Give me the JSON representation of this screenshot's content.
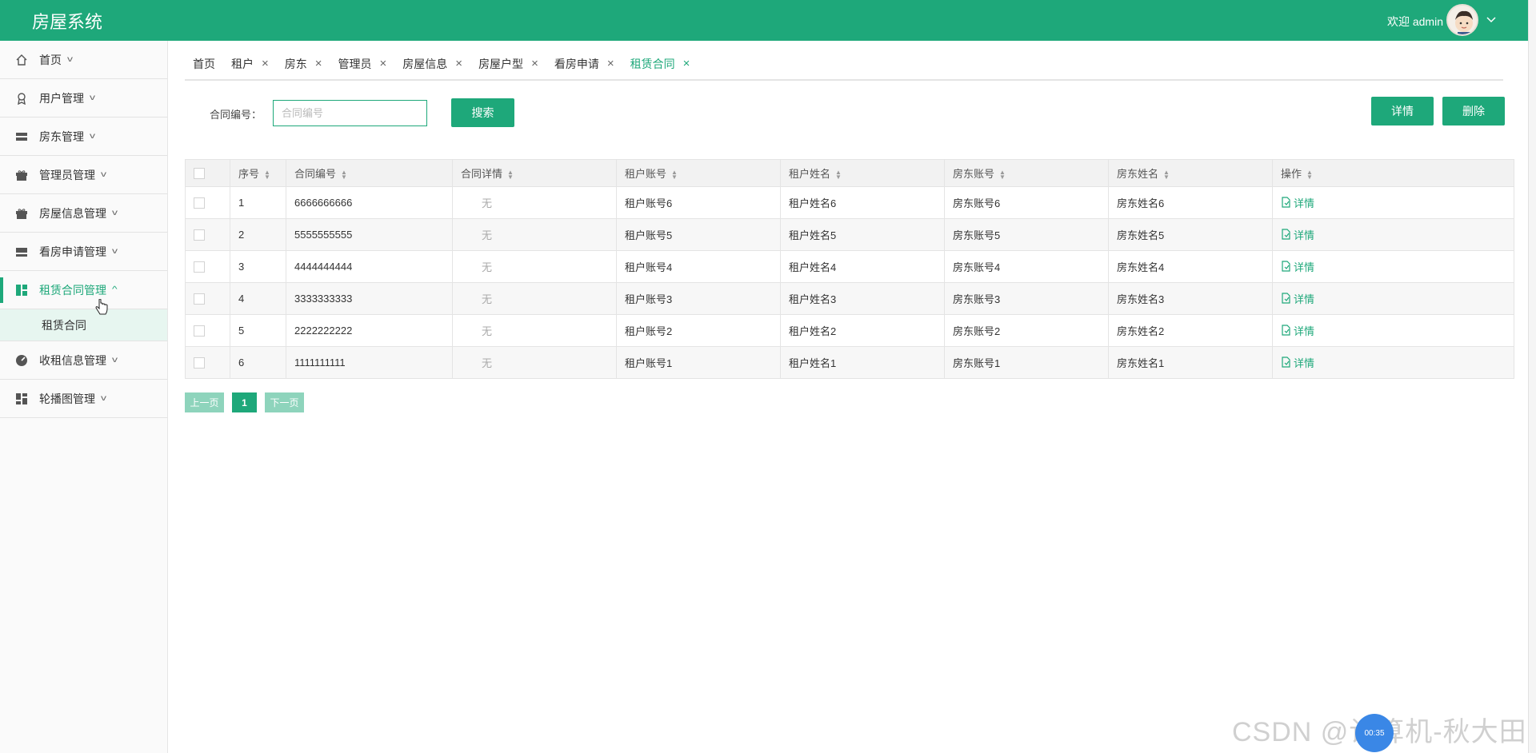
{
  "header": {
    "app_title": "房屋系统",
    "welcome": "欢迎 admin"
  },
  "sidebar": {
    "items": [
      {
        "label": "首页",
        "icon": "home-icon"
      },
      {
        "label": "用户管理",
        "icon": "badge-icon"
      },
      {
        "label": "房东管理",
        "icon": "list-icon"
      },
      {
        "label": "管理员管理",
        "icon": "gift-icon"
      },
      {
        "label": "房屋信息管理",
        "icon": "gift-icon"
      },
      {
        "label": "看房申请管理",
        "icon": "list-icon"
      },
      {
        "label": "租赁合同管理",
        "icon": "dashboard-icon",
        "active": true
      },
      {
        "label": "收租信息管理",
        "icon": "gauge-icon"
      },
      {
        "label": "轮播图管理",
        "icon": "grid-icon"
      }
    ],
    "submenu": {
      "label": "租赁合同"
    }
  },
  "tabs": [
    {
      "label": "首页",
      "closable": false
    },
    {
      "label": "租户",
      "closable": true
    },
    {
      "label": "房东",
      "closable": true
    },
    {
      "label": "管理员",
      "closable": true
    },
    {
      "label": "房屋信息",
      "closable": true
    },
    {
      "label": "房屋户型",
      "closable": true
    },
    {
      "label": "看房申请",
      "closable": true
    },
    {
      "label": "租赁合同",
      "closable": true,
      "active": true
    }
  ],
  "search": {
    "label": "合同编号：",
    "placeholder": "合同编号",
    "value": "",
    "button": "搜索"
  },
  "actions": {
    "detail": "详情",
    "delete": "删除"
  },
  "table": {
    "headers": [
      "序号",
      "合同编号",
      "合同详情",
      "租户账号",
      "租户姓名",
      "房东账号",
      "房东姓名",
      "操作"
    ],
    "rows": [
      {
        "no": "1",
        "contract_no": "6666666666",
        "detail": "无",
        "tenant_account": "租户账号6",
        "tenant_name": "租户姓名6",
        "landlord_account": "房东账号6",
        "landlord_name": "房东姓名6",
        "op": "详情"
      },
      {
        "no": "2",
        "contract_no": "5555555555",
        "detail": "无",
        "tenant_account": "租户账号5",
        "tenant_name": "租户姓名5",
        "landlord_account": "房东账号5",
        "landlord_name": "房东姓名5",
        "op": "详情"
      },
      {
        "no": "3",
        "contract_no": "4444444444",
        "detail": "无",
        "tenant_account": "租户账号4",
        "tenant_name": "租户姓名4",
        "landlord_account": "房东账号4",
        "landlord_name": "房东姓名4",
        "op": "详情"
      },
      {
        "no": "4",
        "contract_no": "3333333333",
        "detail": "无",
        "tenant_account": "租户账号3",
        "tenant_name": "租户姓名3",
        "landlord_account": "房东账号3",
        "landlord_name": "房东姓名3",
        "op": "详情"
      },
      {
        "no": "5",
        "contract_no": "2222222222",
        "detail": "无",
        "tenant_account": "租户账号2",
        "tenant_name": "租户姓名2",
        "landlord_account": "房东账号2",
        "landlord_name": "房东姓名2",
        "op": "详情"
      },
      {
        "no": "6",
        "contract_no": "1111111111",
        "detail": "无",
        "tenant_account": "租户账号1",
        "tenant_name": "租户姓名1",
        "landlord_account": "房东账号1",
        "landlord_name": "房东姓名1",
        "op": "详情"
      }
    ]
  },
  "pagination": {
    "prev": "上一页",
    "current": "1",
    "next": "下一页"
  },
  "watermark": "CSDN @计算机-秋大田",
  "float_ball": "00:35",
  "colors": {
    "accent": "#1ea87a",
    "accent_light": "#8ed4bc",
    "submenu_bg": "#e7f6f0"
  }
}
